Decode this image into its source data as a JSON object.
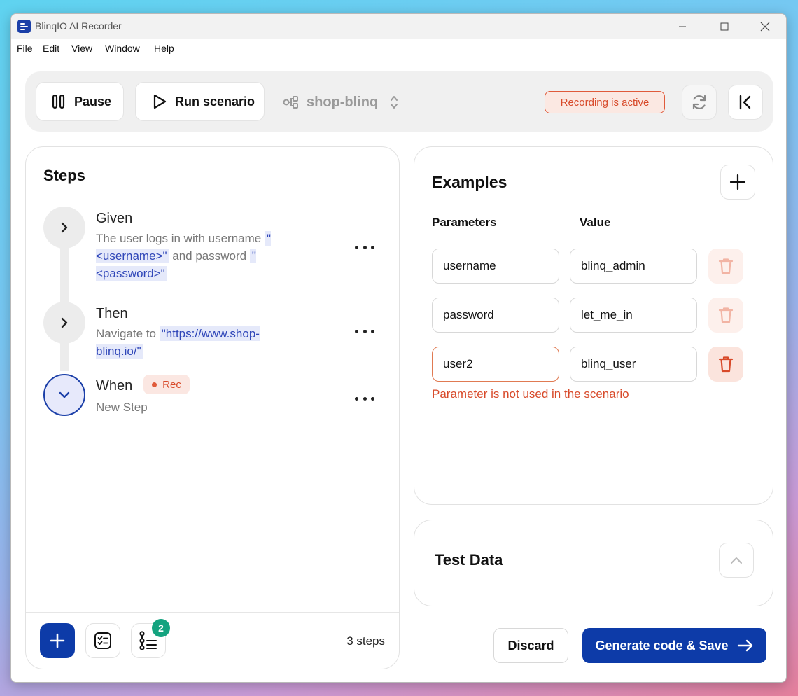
{
  "window": {
    "title": "BlinqIO AI Recorder"
  },
  "menu": [
    "File",
    "Edit",
    "View",
    "Window",
    "Help"
  ],
  "toolbar": {
    "pause_label": "Pause",
    "run_label": "Run scenario",
    "project_name": "shop-blinq",
    "recording_status": "Recording is active"
  },
  "steps_panel": {
    "title": "Steps",
    "steps": [
      {
        "keyword": "Given",
        "text_1": "The user logs in with username",
        "chip_1": "\"<username>\"",
        "text_2": "and password",
        "chip_2": "\"<password>\""
      },
      {
        "keyword": "Then",
        "text_1": "Navigate to",
        "chip_1": "\"https://www.shop-blinq.io/\""
      },
      {
        "keyword": "When",
        "badge": "Rec",
        "text_1": "New Step"
      }
    ],
    "step_count": "3 steps",
    "notification_count": "2"
  },
  "examples_panel": {
    "title": "Examples",
    "col_parameters": "Parameters",
    "col_value": "Value",
    "rows": [
      {
        "parameter": "username",
        "value": "blinq_admin"
      },
      {
        "parameter": "password",
        "value": "let_me_in"
      },
      {
        "parameter": "user2",
        "value": "blinq_user"
      }
    ],
    "error_message": "Parameter is not used in the scenario"
  },
  "test_data_panel": {
    "title": "Test Data"
  },
  "actions": {
    "discard_label": "Discard",
    "generate_label": "Generate code & Save"
  },
  "colors": {
    "primary": "#0d3ba8",
    "recording": "#d84a2a",
    "badge_green": "#14a37f"
  }
}
